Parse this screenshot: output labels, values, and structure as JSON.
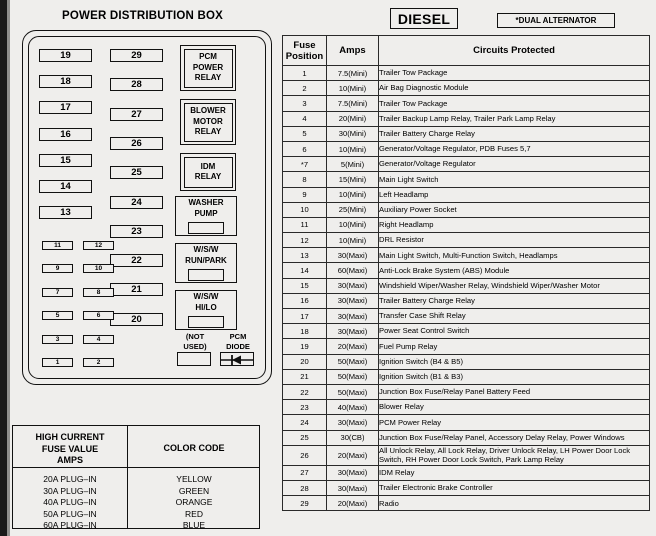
{
  "left_panel": {
    "title": "POWER DISTRIBUTION BOX",
    "column_left_fuses": [
      "19",
      "18",
      "17",
      "16",
      "15",
      "14",
      "13"
    ],
    "column_middle_fuses": [
      "29",
      "28",
      "27",
      "26",
      "25",
      "24",
      "23",
      "22",
      "21",
      "20"
    ],
    "small_fuse_rows": [
      [
        "11",
        "12"
      ],
      [
        "9",
        "10"
      ],
      [
        "7",
        "8"
      ],
      [
        "5",
        "6"
      ],
      [
        "3",
        "4"
      ],
      [
        "1",
        "2"
      ]
    ],
    "relays": [
      {
        "name": "pcm-power-relay",
        "lines": [
          "PCM",
          "POWER",
          "RELAY"
        ],
        "has_slot": false
      },
      {
        "name": "blower-motor-relay",
        "lines": [
          "BLOWER",
          "MOTOR",
          "RELAY"
        ],
        "has_slot": false
      },
      {
        "name": "idm-relay",
        "lines": [
          "IDM",
          "RELAY"
        ],
        "has_slot": false
      },
      {
        "name": "washer-pump",
        "lines": [
          "WASHER",
          "PUMP"
        ],
        "has_slot": true
      },
      {
        "name": "wsw-run-park",
        "lines": [
          "W/S/W",
          "RUN/PARK"
        ],
        "has_slot": true
      },
      {
        "name": "wsw-hi-lo",
        "lines": [
          "W/S/W",
          "HI/LO"
        ],
        "has_slot": true
      }
    ],
    "bottom_slots": [
      {
        "name": "not-used",
        "line1": "(NOT",
        "line2": "USED)"
      },
      {
        "name": "pcm-diode",
        "line1": "PCM",
        "line2": "DIODE"
      }
    ]
  },
  "legend": {
    "header_left": [
      "HIGH CURRENT",
      "FUSE VALUE",
      "AMPS"
    ],
    "header_right": "COLOR CODE",
    "rows": [
      {
        "value": "20A PLUG–IN",
        "color": "YELLOW"
      },
      {
        "value": "30A PLUG–IN",
        "color": "GREEN"
      },
      {
        "value": "40A PLUG–IN",
        "color": "ORANGE"
      },
      {
        "value": "50A PLUG–IN",
        "color": "RED"
      },
      {
        "value": "60A PLUG–IN",
        "color": "BLUE"
      }
    ]
  },
  "header_chips": {
    "diesel": "DIESEL",
    "dual_alternator": "*DUAL ALTERNATOR"
  },
  "table": {
    "headers": {
      "position_line1": "Fuse",
      "position_line2": "Position",
      "amps": "Amps",
      "circuits": "Circuits Protected"
    },
    "rows": [
      {
        "pos": "1",
        "amps": "7.5(Mini)",
        "circuits": "Trailer Tow Package"
      },
      {
        "pos": "2",
        "amps": "10(Mini)",
        "circuits": "Air Bag Diagnostic Module"
      },
      {
        "pos": "3",
        "amps": "7.5(Mini)",
        "circuits": "Trailer Tow Package"
      },
      {
        "pos": "4",
        "amps": "20(Mini)",
        "circuits": "Trailer Backup Lamp Relay, Trailer Park Lamp Relay"
      },
      {
        "pos": "5",
        "amps": "30(Mini)",
        "circuits": "Trailer Battery Charge Relay"
      },
      {
        "pos": "6",
        "amps": "10(Mini)",
        "circuits": "Generator/Voltage  Regulator, PDB Fuses 5,7"
      },
      {
        "pos": "*7",
        "amps": "5(Mini)",
        "circuits": "Generator/Voltage Regulator"
      },
      {
        "pos": "8",
        "amps": "15(Mini)",
        "circuits": "Main Light Switch"
      },
      {
        "pos": "9",
        "amps": "10(Mini)",
        "circuits": "Left Headlamp"
      },
      {
        "pos": "10",
        "amps": "25(Mini)",
        "circuits": "Auxiliary Power Socket"
      },
      {
        "pos": "11",
        "amps": "10(Mini)",
        "circuits": "Right Headlamp"
      },
      {
        "pos": "12",
        "amps": "10(Mini)",
        "circuits": "DRL Resistor"
      },
      {
        "pos": "13",
        "amps": "30(Maxi)",
        "circuits": "Main Light Switch, Multi-Function Switch, Headlamps"
      },
      {
        "pos": "14",
        "amps": "60(Maxi)",
        "circuits": "Anti-Lock Brake System (ABS) Module"
      },
      {
        "pos": "15",
        "amps": "30(Maxi)",
        "circuits": "Windshield Wiper/Washer Relay, Windshield Wiper/Washer Motor"
      },
      {
        "pos": "16",
        "amps": "30(Maxi)",
        "circuits": "Trailer Battery Charge Relay"
      },
      {
        "pos": "17",
        "amps": "30(Maxi)",
        "circuits": "Transfer Case Shift Relay"
      },
      {
        "pos": "18",
        "amps": "30(Maxi)",
        "circuits": "Power Seat Control Switch"
      },
      {
        "pos": "19",
        "amps": "20(Maxi)",
        "circuits": "Fuel Pump Relay"
      },
      {
        "pos": "20",
        "amps": "50(Maxi)",
        "circuits": "Ignition Switch (B4 & B5)"
      },
      {
        "pos": "21",
        "amps": "50(Maxi)",
        "circuits": "Ignition Switch (B1 & B3)"
      },
      {
        "pos": "22",
        "amps": "50(Maxi)",
        "circuits": "Junction Box Fuse/Relay Panel Battery Feed"
      },
      {
        "pos": "23",
        "amps": "40(Maxi)",
        "circuits": "Blower Relay"
      },
      {
        "pos": "24",
        "amps": "30(Maxi)",
        "circuits": "PCM Power Relay"
      },
      {
        "pos": "25",
        "amps": "30(CB)",
        "circuits": "Junction Box Fuse/Relay Panel, Accessory Delay Relay, Power Windows"
      },
      {
        "pos": "26",
        "amps": "20(Maxi)",
        "circuits": "All Unlock Relay, All Lock Relay, Driver Unlock Relay, LH Power Door Lock Switch, RH Power Door Lock Switch, Park Lamp Relay",
        "tall": true
      },
      {
        "pos": "27",
        "amps": "30(Maxi)",
        "circuits": "IDM Relay"
      },
      {
        "pos": "28",
        "amps": "30(Maxi)",
        "circuits": "Trailer Electronic Brake Controller"
      },
      {
        "pos": "29",
        "amps": "20(Maxi)",
        "circuits": "Radio"
      }
    ]
  }
}
